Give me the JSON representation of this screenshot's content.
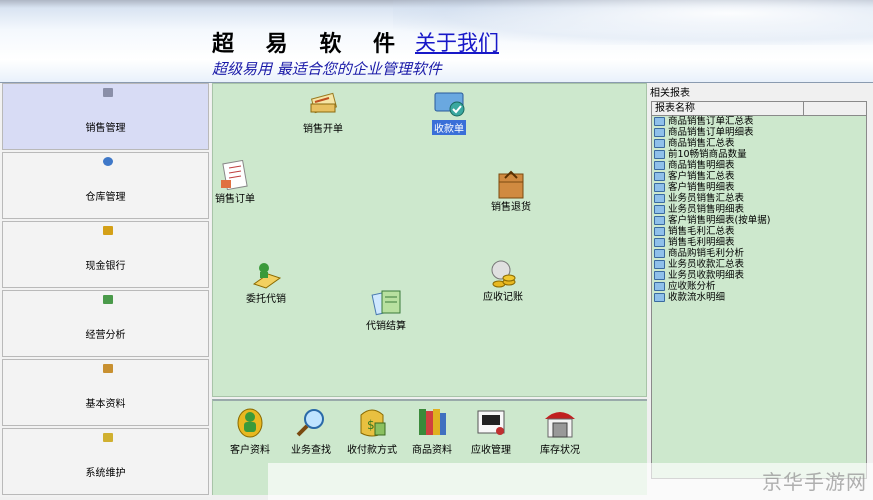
{
  "header": {
    "brand": "超 易 软 件",
    "about_link": "关于我们",
    "slogan": "超级易用 最适合您的企业管理软件"
  },
  "nav": {
    "items": [
      {
        "label": "销售管理",
        "icon": "sales-icon",
        "color": "#8a8fa8"
      },
      {
        "label": "仓库管理",
        "icon": "warehouse-icon",
        "color": "#3f78c8"
      },
      {
        "label": "现金银行",
        "icon": "cash-icon",
        "color": "#d4a017"
      },
      {
        "label": "经营分析",
        "icon": "chart-icon",
        "color": "#4a9a4a"
      },
      {
        "label": "基本资料",
        "icon": "data-icon",
        "color": "#c89030"
      },
      {
        "label": "系统维护",
        "icon": "maintenance-icon",
        "color": "#d0b030"
      }
    ]
  },
  "workspace": {
    "items": [
      {
        "label": "销售开单",
        "icon": "sales-invoice-icon"
      },
      {
        "label": "收款单",
        "icon": "receipt-icon"
      },
      {
        "label": "销售订单",
        "icon": "sales-order-icon"
      },
      {
        "label": "销售退货",
        "icon": "sales-return-icon"
      },
      {
        "label": "委托代销",
        "icon": "consignment-icon"
      },
      {
        "label": "应收记账",
        "icon": "receivable-icon"
      },
      {
        "label": "代销结算",
        "icon": "consignment-settlement-icon"
      }
    ]
  },
  "toolbar": {
    "items": [
      {
        "label": "客户资料",
        "icon": "customer-icon"
      },
      {
        "label": "业务查找",
        "icon": "search-icon"
      },
      {
        "label": "收付款方式",
        "icon": "payment-method-icon"
      },
      {
        "label": "商品资料",
        "icon": "product-icon"
      },
      {
        "label": "应收管理",
        "icon": "receivable-manage-icon"
      },
      {
        "label": "库存状况",
        "icon": "inventory-icon"
      }
    ]
  },
  "reports": {
    "title": "相关报表",
    "column_header": "报表名称",
    "items": [
      "商品销售订单汇总表",
      "商品销售订单明细表",
      "商品销售汇总表",
      "前10畅销商品数量",
      "商品销售明细表",
      "客户销售汇总表",
      "客户销售明细表",
      "业务员销售汇总表",
      "业务员销售明细表",
      "客户销售明细表(按单据)",
      "销售毛利汇总表",
      "销售毛利明细表",
      "商品购销毛利分析",
      "业务员收款汇总表",
      "业务员收款明细表",
      "应收账分析",
      "收款流水明细"
    ]
  },
  "watermark": "京华手游网"
}
